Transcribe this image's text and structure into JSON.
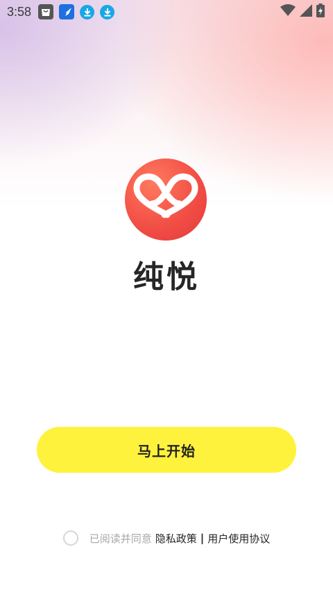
{
  "status_bar": {
    "time": "3:58",
    "icons": [
      "shopping-bag-icon",
      "bird-app-icon",
      "download-icon",
      "download-icon",
      "wifi-icon",
      "cellular-signal-icon",
      "battery-charging-icon"
    ]
  },
  "app": {
    "name": "纯悦",
    "logo_icon": "double-heart-logo-icon",
    "brand_color": "#f24f46"
  },
  "start_button": {
    "label": "马上开始",
    "color": "#fff23c"
  },
  "agreement": {
    "checked": false,
    "prefix": "已阅读并同意",
    "privacy_policy": "隐私政策",
    "separator": "|",
    "user_agreement": "用户使用协议"
  }
}
